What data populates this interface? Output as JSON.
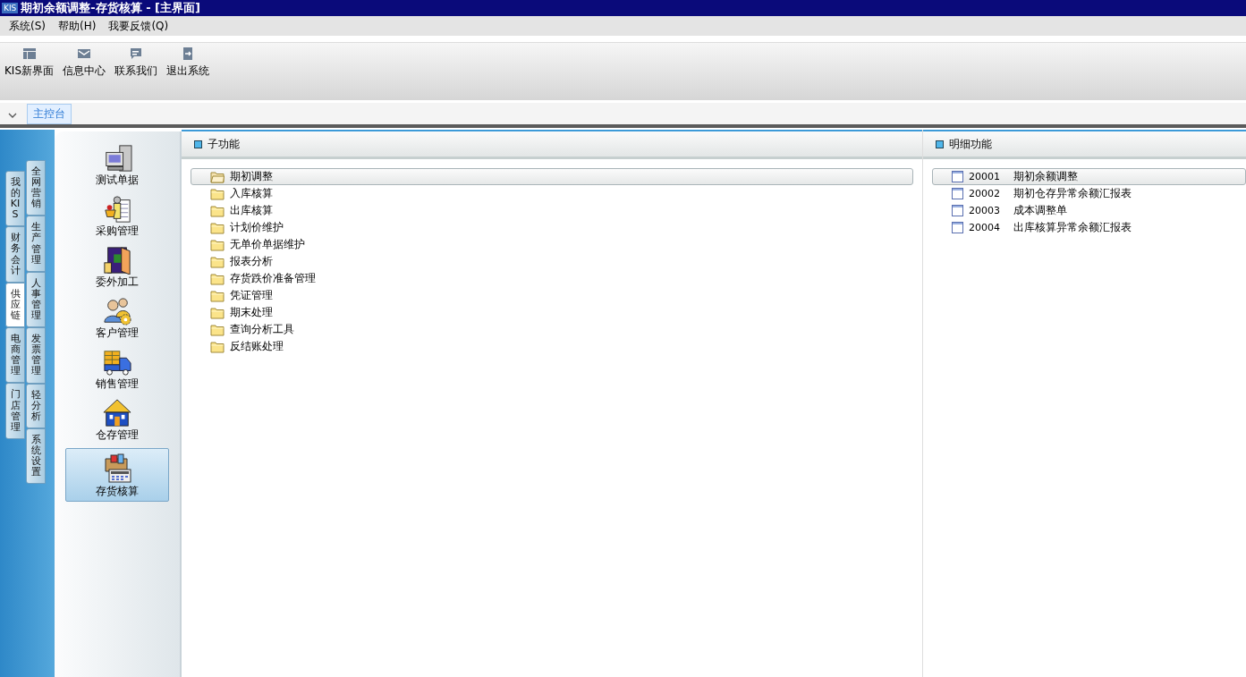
{
  "window": {
    "title": "期初余额调整-存货核算 - [主界面]",
    "logo": "KIS"
  },
  "menu": [
    "系统(S)",
    "帮助(H)",
    "我要反馈(Q)"
  ],
  "toolbar": [
    "KIS新界面",
    "信息中心",
    "联系我们",
    "退出系统"
  ],
  "tabs": [
    {
      "label": "主控台",
      "selected": true
    }
  ],
  "nav_tabs_outer": [
    {
      "label": "我的KIS",
      "selected": false
    },
    {
      "label": "财务会计",
      "selected": false
    },
    {
      "label": "供应链",
      "selected": true
    },
    {
      "label": "电商管理",
      "selected": false
    },
    {
      "label": "门店管理",
      "selected": false
    }
  ],
  "nav_tabs_inner": [
    {
      "label": "全网营销",
      "selected": false
    },
    {
      "label": "生产管理",
      "selected": false
    },
    {
      "label": "人事管理",
      "selected": false
    },
    {
      "label": "发票管理",
      "selected": false
    },
    {
      "label": "轻分析",
      "selected": false
    },
    {
      "label": "系统设置",
      "selected": false
    }
  ],
  "modules": [
    {
      "label": "测试单据",
      "selected": false
    },
    {
      "label": "采购管理",
      "selected": false
    },
    {
      "label": "委外加工",
      "selected": false
    },
    {
      "label": "客户管理",
      "selected": false
    },
    {
      "label": "销售管理",
      "selected": false
    },
    {
      "label": "仓存管理",
      "selected": false
    },
    {
      "label": "存货核算",
      "selected": true
    }
  ],
  "sub_functions": {
    "title": "子功能",
    "items": [
      {
        "label": "期初调整",
        "selected": true
      },
      {
        "label": "入库核算",
        "selected": false
      },
      {
        "label": "出库核算",
        "selected": false
      },
      {
        "label": "计划价维护",
        "selected": false
      },
      {
        "label": "无单价单据维护",
        "selected": false
      },
      {
        "label": "报表分析",
        "selected": false
      },
      {
        "label": "存货跌价准备管理",
        "selected": false
      },
      {
        "label": "凭证管理",
        "selected": false
      },
      {
        "label": "期末处理",
        "selected": false
      },
      {
        "label": "查询分析工具",
        "selected": false
      },
      {
        "label": "反结账处理",
        "selected": false
      }
    ]
  },
  "detail_functions": {
    "title": "明细功能",
    "items": [
      {
        "code": "20001",
        "label": "期初余额调整",
        "selected": true
      },
      {
        "code": "20002",
        "label": "期初仓存异常余额汇报表",
        "selected": false
      },
      {
        "code": "20003",
        "label": "成本调整单",
        "selected": false
      },
      {
        "code": "20004",
        "label": "出库核算异常余额汇报表",
        "selected": false
      }
    ]
  }
}
